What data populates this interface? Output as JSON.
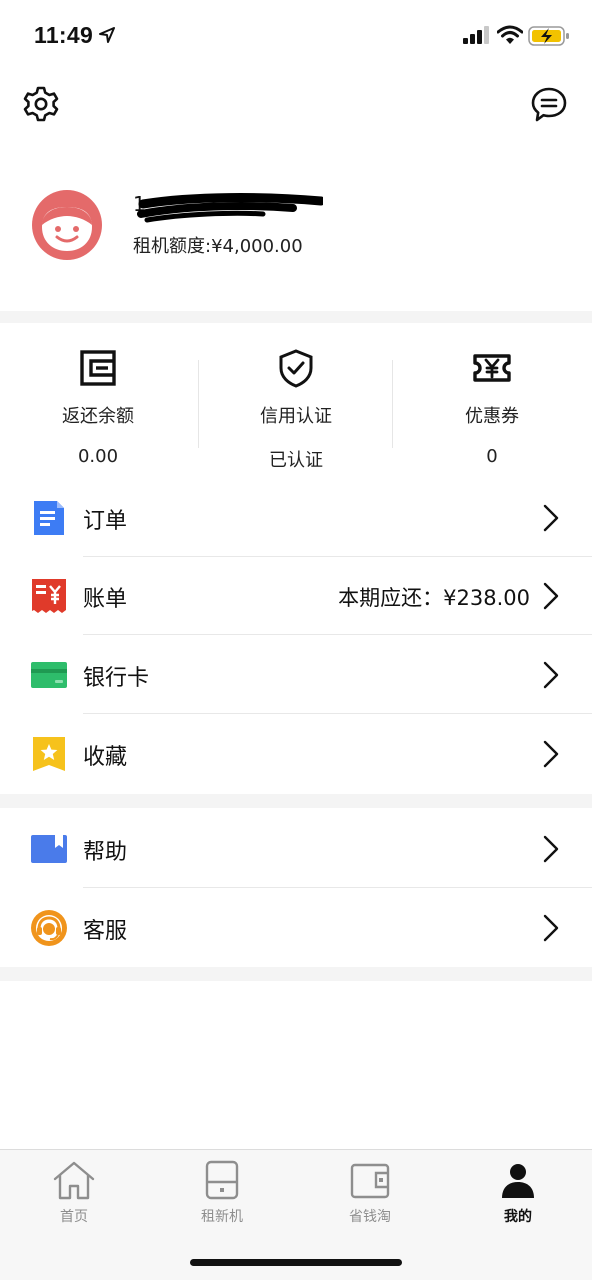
{
  "status_bar": {
    "time": "11:49"
  },
  "profile": {
    "phone_visible_prefix": "1",
    "credit_label": "租机额度:¥4,000.00"
  },
  "stats": [
    {
      "title": "返还余额",
      "value": "0.00",
      "icon": "wallet-icon"
    },
    {
      "title": "信用认证",
      "value": "已认证",
      "icon": "shield-check-icon"
    },
    {
      "title": "优惠券",
      "value": "0",
      "icon": "coupon-icon"
    }
  ],
  "menu": [
    {
      "label": "订单",
      "value": "",
      "icon": "order-document-icon",
      "color": "#3d7cf4"
    },
    {
      "label": "账单",
      "value": "本期应还：¥238.00",
      "icon": "bill-icon",
      "color": "#e03a2a"
    },
    {
      "label": "银行卡",
      "value": "",
      "icon": "bank-card-icon",
      "color": "#2ebd6b"
    },
    {
      "label": "收藏",
      "value": "",
      "icon": "favorite-star-icon",
      "color": "#f6c21c"
    }
  ],
  "menu2": [
    {
      "label": "帮助",
      "value": "",
      "icon": "help-book-icon",
      "color": "#4a7bea"
    },
    {
      "label": "客服",
      "value": "",
      "icon": "customer-service-icon",
      "color": "#f0941c"
    }
  ],
  "tabs": [
    {
      "label": "首页",
      "icon": "home-icon",
      "active": false
    },
    {
      "label": "租新机",
      "icon": "phone-device-icon",
      "active": false
    },
    {
      "label": "省钱淘",
      "icon": "wallet-tab-icon",
      "active": false
    },
    {
      "label": "我的",
      "icon": "person-icon",
      "active": true
    }
  ]
}
